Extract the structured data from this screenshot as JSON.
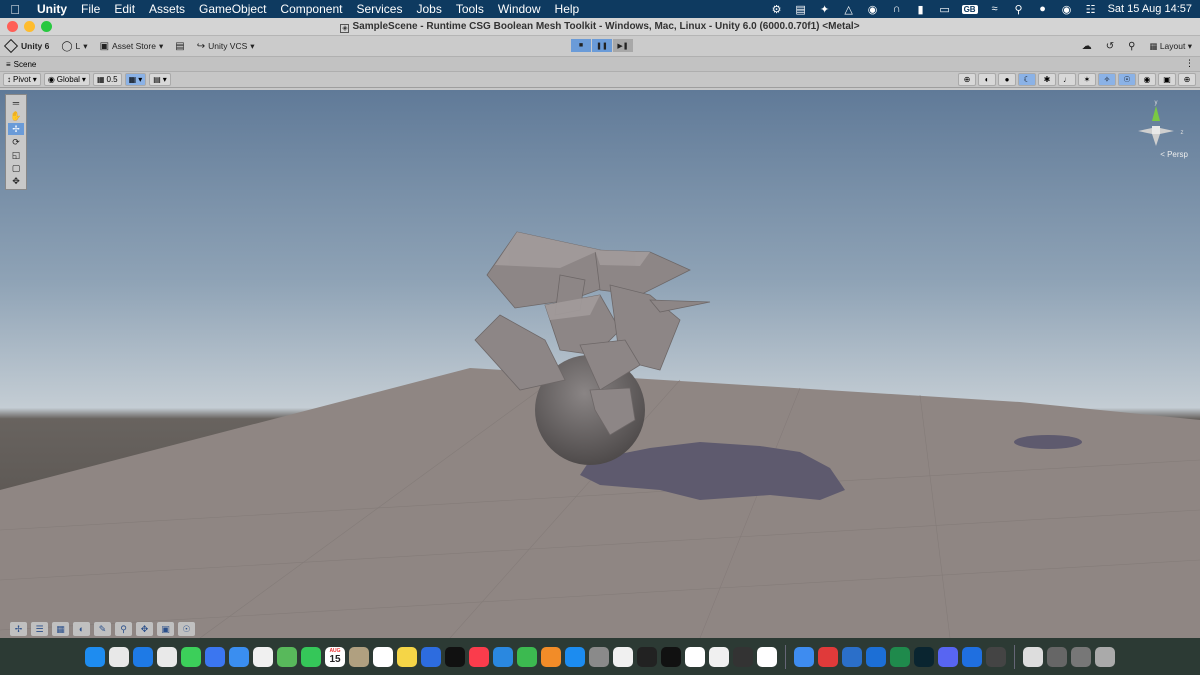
{
  "menubar": {
    "app_name": "Unity",
    "menus": [
      "File",
      "Edit",
      "Assets",
      "GameObject",
      "Component",
      "Services",
      "Jobs",
      "Tools",
      "Window",
      "Help"
    ],
    "keyboard_layout": "GB",
    "clock": "Sat 15 Aug  14:57"
  },
  "window": {
    "title": "SampleScene - Runtime CSG Boolean Mesh Toolkit - Windows, Mac, Linux - Unity 6.0 (6000.0.70f1) <Metal>"
  },
  "toolbar": {
    "unity_version_label": "Unity 6",
    "account_label": "L",
    "asset_store_label": "Asset Store",
    "vcs_label": "Unity VCS",
    "layout_label": "Layout"
  },
  "scene_tab": {
    "label": "Scene"
  },
  "scene_options": {
    "pivot_label": "Pivot",
    "global_label": "Global",
    "snap_value": "0.5"
  },
  "viewport": {
    "projection_label": "Persp",
    "gizmo_axis_y": "y",
    "gizmo_axis_z": "z"
  },
  "dock": {
    "calendar_day": "15",
    "calendar_month": "AUG",
    "apps": [
      {
        "icon": "finder-icon",
        "color": "#1e8cf0"
      },
      {
        "icon": "launchpad-icon",
        "color": "#e8e8e8"
      },
      {
        "icon": "safari-icon",
        "color": "#1e7ae6"
      },
      {
        "icon": "chrome-icon",
        "color": "#e9e9e9"
      },
      {
        "icon": "messages-icon",
        "color": "#3ccf5a"
      },
      {
        "icon": "signal-icon",
        "color": "#3b76f0"
      },
      {
        "icon": "mail-icon",
        "color": "#3a8ef0"
      },
      {
        "icon": "photos-icon",
        "color": "#f0f0f0"
      },
      {
        "icon": "maps-icon",
        "color": "#58b95b"
      },
      {
        "icon": "facetime-icon",
        "color": "#35c759"
      },
      {
        "icon": "calendar-icon",
        "color": "#ffffff"
      },
      {
        "icon": "contacts-icon",
        "color": "#b0a080"
      },
      {
        "icon": "reminders-icon",
        "color": "#ffffff"
      },
      {
        "icon": "notes-icon",
        "color": "#f5d547"
      },
      {
        "icon": "freeform-icon",
        "color": "#2d6cdf"
      },
      {
        "icon": "tv-icon",
        "color": "#111111"
      },
      {
        "icon": "music-icon",
        "color": "#fa3c4c"
      },
      {
        "icon": "keynote-icon",
        "color": "#2a88e0"
      },
      {
        "icon": "numbers-icon",
        "color": "#3cba50"
      },
      {
        "icon": "pages-icon",
        "color": "#f28c28"
      },
      {
        "icon": "app-store-icon",
        "color": "#1c8cf0"
      },
      {
        "icon": "system-settings-icon",
        "color": "#8a8a8a"
      },
      {
        "icon": "news-icon",
        "color": "#f0f0f0"
      },
      {
        "icon": "terminal-icon",
        "color": "#222222"
      },
      {
        "icon": "chatgpt-icon",
        "color": "#111111"
      },
      {
        "icon": "openai-icon",
        "color": "#ffffff"
      },
      {
        "icon": "arc-icon",
        "color": "#f0f0f0"
      },
      {
        "icon": "unity-hub-icon",
        "color": "#333333"
      },
      {
        "icon": "copilot-icon",
        "color": "#ffffff"
      },
      {
        "icon": "folder-icon",
        "color": "#3e8cf0"
      },
      {
        "icon": "acrobat-icon",
        "color": "#e03a3a"
      },
      {
        "icon": "disk-utility-icon",
        "color": "#2b6fc9"
      },
      {
        "icon": "quicktime-icon",
        "color": "#1c6fd6"
      },
      {
        "icon": "excel-icon",
        "color": "#1f8a4c"
      },
      {
        "icon": "podcast-icon",
        "color": "#0a2530"
      },
      {
        "icon": "discord-icon",
        "color": "#5865f2"
      },
      {
        "icon": "xcode-icon",
        "color": "#1f6fe0"
      },
      {
        "icon": "unity-icon",
        "color": "#444444"
      },
      {
        "icon": "documents-icon",
        "color": "#dddddd"
      },
      {
        "icon": "downloads-icon",
        "color": "#666666"
      },
      {
        "icon": "screenshots-icon",
        "color": "#777777"
      },
      {
        "icon": "trash-icon",
        "color": "#aaaaaa"
      }
    ]
  }
}
